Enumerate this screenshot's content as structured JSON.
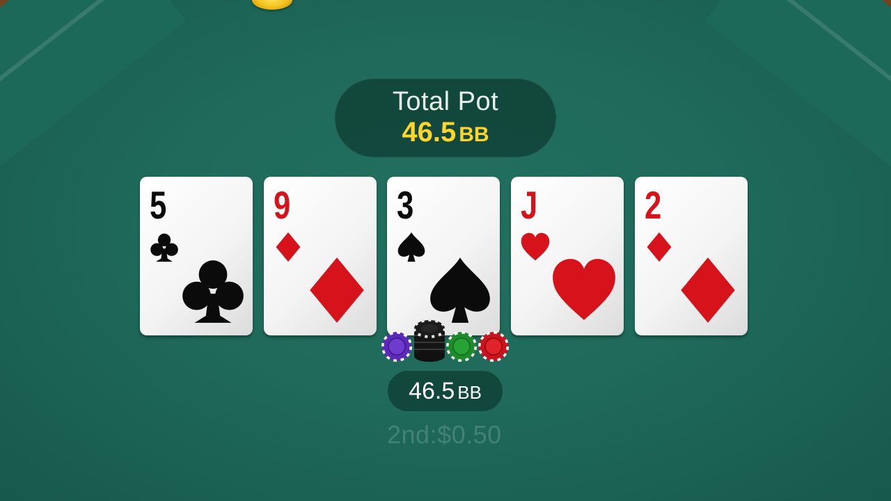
{
  "pot": {
    "title": "Total Pot",
    "amount": "46.5",
    "unit": "BB"
  },
  "board": {
    "cards": [
      {
        "rank": "5",
        "suit": "clubs",
        "color": "black"
      },
      {
        "rank": "9",
        "suit": "diamonds",
        "color": "red"
      },
      {
        "rank": "3",
        "suit": "spades",
        "color": "black"
      },
      {
        "rank": "J",
        "suit": "hearts",
        "color": "red"
      },
      {
        "rank": "2",
        "suit": "diamonds",
        "color": "red"
      }
    ]
  },
  "bet": {
    "amount": "46.5",
    "unit": "BB"
  },
  "payout": {
    "text": "2nd:$0.50"
  },
  "colors": {
    "felt": "#1f6a5b",
    "pot_amount": "#ffd52a",
    "card_red": "#d6121b",
    "card_black": "#0b0b0b"
  }
}
